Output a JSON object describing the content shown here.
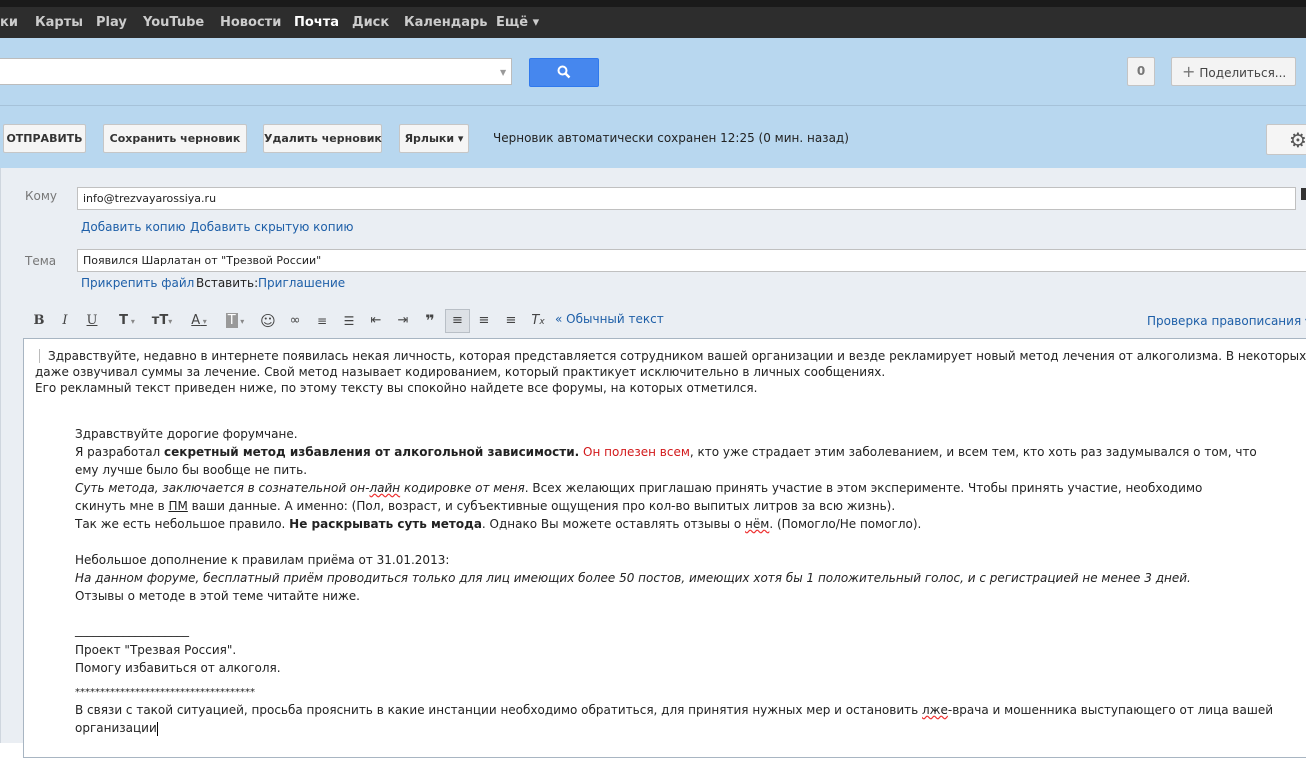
{
  "topnav": {
    "items": [
      "ки",
      "Карты",
      "Play",
      "YouTube",
      "Новости",
      "Почта",
      "Диск",
      "Календарь",
      "Ещё ▾"
    ],
    "active": "Почта"
  },
  "search": {
    "value": ""
  },
  "share": {
    "notif_count": "0",
    "share_label": "Поделиться..."
  },
  "toolbar": {
    "send": "ОТПРАВИТЬ",
    "save_draft": "Сохранить черновик",
    "delete_draft": "Удалить черновик",
    "labels": "Ярлыки ▾",
    "autosave": "Черновик автоматически сохранен 12:25 (0 мин. назад)"
  },
  "compose": {
    "to_label": "Кому",
    "to_value": "info@trezvayarossiya.ru",
    "add_cc": "Добавить копию",
    "add_bcc": "Добавить скрытую копию",
    "subject_label": "Тема",
    "subject_value": "Появился Шарлатан от \"Трезвой России\"",
    "attach": "Прикрепить файл",
    "insert": "Вставить:",
    "invitation": "Приглашение",
    "plain_text": "« Обычный текст",
    "spellcheck": "Проверка правописания ▾"
  },
  "format_icons": [
    "bold-icon",
    "italic-icon",
    "underline-icon",
    "font-icon",
    "font-size-icon",
    "text-color-icon",
    "highlight-color-icon",
    "emoji-icon",
    "link-icon",
    "numbered-list-icon",
    "bulleted-list-icon",
    "indent-less-icon",
    "indent-more-icon",
    "quote-icon",
    "align-left-icon",
    "align-center-icon",
    "align-right-icon",
    "remove-formatting-icon"
  ],
  "body": {
    "p1_l1": "Здравствуйте, недавно в интернете появилась некая личность, которая представляется сотрудником вашей организации и везде рекламирует новый метод лечения от алкоголизма. В некоторых случаях",
    "p1_l2": "даже озвучивал суммы за лечение. Свой метод называет кодированием, который практикует исключительно в личных сообщениях.",
    "p1_l3": "Его рекламный текст приведен ниже, по этому тексту вы спокойно найдете все форумы, на которых отметился.",
    "q_greet": "Здравствуйте дорогие форумчане.",
    "q2_a": "Я разработал ",
    "q2_b": "секретный метод избавления от алкогольной зависимости.",
    "q2_c": " Он полезен всем",
    "q2_d": ", кто уже страдает этим заболеванием, и всем тем, кто хоть раз задумывался о том, что",
    "q3": "ему лучше было бы вообще не пить.",
    "q4_a": "Суть метода, заключается в сознательной он-",
    "q4_b": "лайн",
    "q4_c": " кодировке от меня",
    "q4_d": ". Всех желающих приглашаю принять участие в этом эксперименте. Чтобы принять участие, необходимо",
    "q5_a": "скинуть мне в ",
    "q5_b": "ПМ",
    "q5_c": " ваши данные. А именно: (Пол, возраст, и субъективные ощущения про кол-во выпитых литров за всю жизнь).",
    "q6_a": "Так же есть небольшое правило. ",
    "q6_b": "Не раскрывать суть метода",
    "q6_c": ". Однако Вы можете оставлять отзывы о ",
    "q6_d": "нём",
    "q6_e": ". (Помогло/Не помогло).",
    "q7": "Небольшое дополнение к правилам приёма от 31.01.2013:",
    "q8": "На данном форуме, бесплатный приём проводиться только для лиц имеющих более 50 постов, имеющих хотя бы 1 положительный голос, и с регистрацией не менее 3 дней.",
    "q9": "Отзывы о методе в этой теме читайте ниже.",
    "sig_line": "___________________",
    "sig1": "Проект \"Трезвая Россия\".",
    "sig2": "Помогу избавиться от алкоголя.",
    "stars": "************************************",
    "end_a": "В связи с такой ситуацией, просьба прояснить в какие инстанции необходимо обратиться, для принятия нужных мер и остановить ",
    "end_b": "лже",
    "end_c": "-врача и мошенника выступающего от лица вашей",
    "end2": "организации"
  }
}
